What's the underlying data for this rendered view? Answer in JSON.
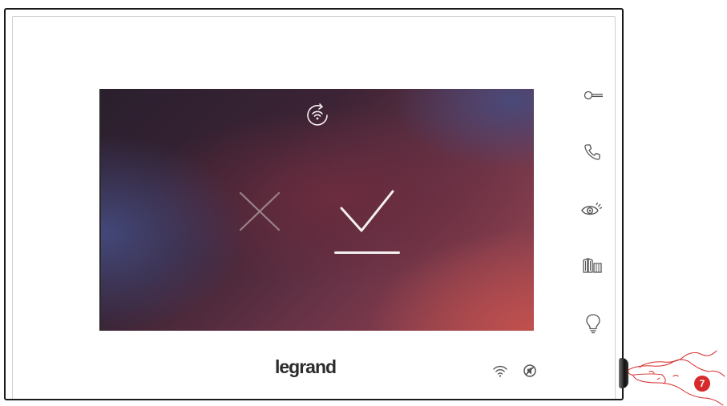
{
  "device": {
    "brand": "legrand",
    "step_number": "7"
  },
  "screen": {
    "top_icon": "wifi-refresh-icon",
    "actions": [
      {
        "name": "cancel",
        "icon": "x-icon",
        "selected": false
      },
      {
        "name": "confirm",
        "icon": "checkmark-icon",
        "selected": true
      }
    ]
  },
  "side_buttons": [
    {
      "name": "door-lock",
      "icon": "key-icon"
    },
    {
      "name": "answer-call",
      "icon": "phone-icon"
    },
    {
      "name": "camera-view",
      "icon": "eye-icon"
    },
    {
      "name": "gate",
      "icon": "gate-icon"
    },
    {
      "name": "stair-light",
      "icon": "light-bulb-icon"
    }
  ],
  "status_icons": [
    "wifi-icon",
    "mute-icon"
  ],
  "colors": {
    "badge": "#d62b2b",
    "hand_outline": "#d62b2b",
    "icon_gray": "#555555",
    "screen_text": "#f4f0f0"
  }
}
